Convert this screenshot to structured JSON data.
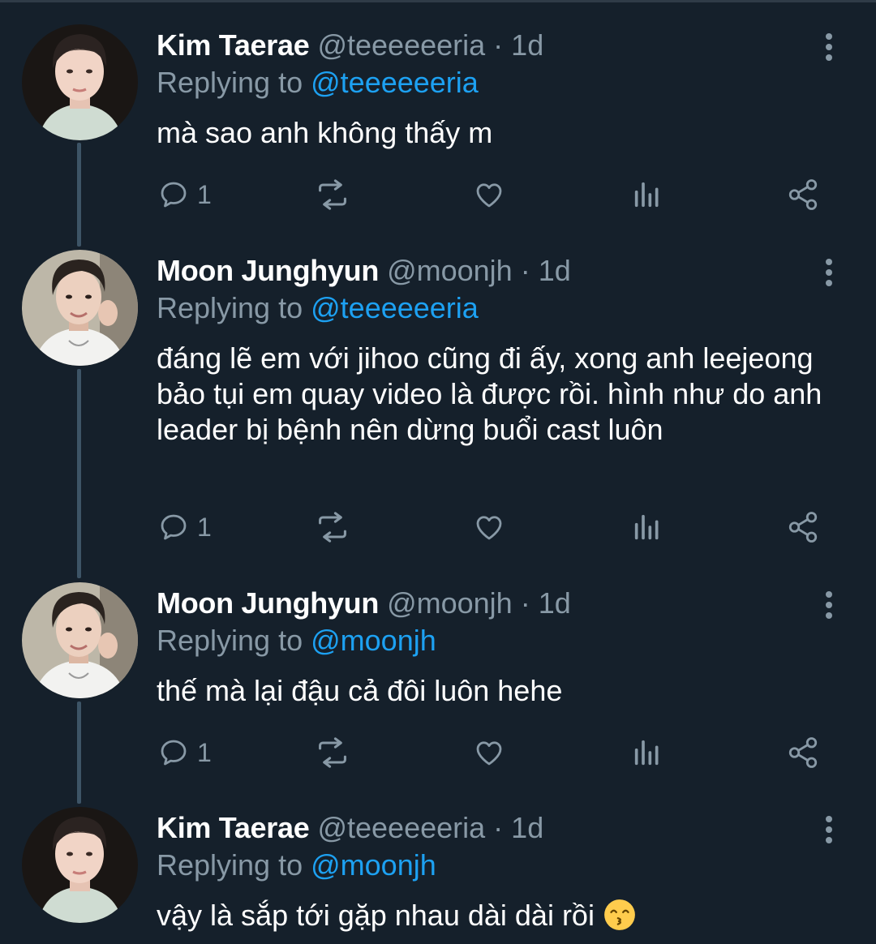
{
  "theme": {
    "background": "#15202b",
    "text": "#ffffff",
    "muted": "#8899a6",
    "accent": "#1da1f2",
    "thread_line": "#3d5466"
  },
  "tweets": [
    {
      "name": "Kim Taerae",
      "handle": "@teeeeeeria",
      "separator": "·",
      "time": "1d",
      "replying_prefix": "Replying to",
      "replying_to": "@teeeeeeria",
      "text": "mà sao anh không thấy m",
      "reply_count": "1",
      "avatar": "avatar-kim-taerae"
    },
    {
      "name": "Moon Junghyun",
      "handle": "@moonjh",
      "separator": "·",
      "time": "1d",
      "replying_prefix": "Replying to",
      "replying_to": "@teeeeeeria",
      "text": "đáng lẽ em với jihoo cũng đi ấy, xong anh leejeong bảo tụi em quay video là được rồi. hình như do anh leader bị bệnh nên dừng buổi cast luôn",
      "reply_count": "1",
      "avatar": "avatar-moon-junghyun"
    },
    {
      "name": "Moon Junghyun",
      "handle": "@moonjh",
      "separator": "·",
      "time": "1d",
      "replying_prefix": "Replying to",
      "replying_to": "@moonjh",
      "text": "thế mà lại đậu cả đôi luôn hehe",
      "reply_count": "1",
      "avatar": "avatar-moon-junghyun"
    },
    {
      "name": "Kim Taerae",
      "handle": "@teeeeeeria",
      "separator": "·",
      "time": "1d",
      "replying_prefix": "Replying to",
      "replying_to": "@moonjh",
      "text": "vậy là sắp tới gặp nhau dài dài rồi",
      "text_emoji": "kissing-smiling-eyes-emoji",
      "avatar": "avatar-kim-taerae"
    }
  ],
  "icons": {
    "reply": "reply-icon",
    "retweet": "retweet-icon",
    "like": "like-icon",
    "analytics": "analytics-icon",
    "share": "share-icon",
    "more": "more-icon"
  }
}
